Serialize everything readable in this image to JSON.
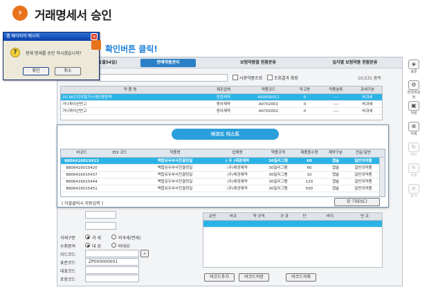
{
  "header": {
    "title": "거래명세서 승인",
    "icon": "chevron-right-icon"
  },
  "annotation": "확인버튼 클릭!",
  "tabs": [
    {
      "label": "31월54일)"
    },
    {
      "label": "판매약품관리"
    },
    {
      "label": "보험약품별 현황분류"
    },
    {
      "label": "일자별 보험약품 현황분류"
    }
  ],
  "search": {
    "chk1": "사용약품조회",
    "chk2": "조회결과 확장",
    "count": "10,531 품목"
  },
  "main_grid": {
    "columns": [
      "약 품 명",
      "제조업체",
      "약품코드",
      "마고량",
      "약품분류",
      "과세구분"
    ],
    "rows": [
      [
        "20.38건강양철가스레산용량액",
        "동원제약",
        "A00000011",
        "0",
        "----",
        "비과세"
      ],
      [
        "거나파이산반고",
        "동아제약",
        "A0702001",
        "0",
        "----",
        "비과세"
      ],
      [
        "거나파이산반고",
        "동아제약",
        "A0702002",
        "0",
        "----",
        "비과세"
      ]
    ]
  },
  "popup": {
    "title": "바코드 리스트",
    "columns": [
      "바코드",
      "EDI 코드",
      "약품명",
      "업체명",
      "약품규격",
      "제품충수량",
      "제약구분",
      "전문/일반"
    ],
    "rows": [
      [
        "8806416015413",
        "",
        "백합유두부사전결정일",
        "( 주 )태광제약",
        "30밀리그램",
        "60",
        "캡슐",
        "일반의약품"
      ],
      [
        "8806416015420",
        "",
        "백합유두부사전결정일",
        "(주)태광제약",
        "30밀리그램",
        "60",
        "캡슐",
        "일반의약품"
      ],
      [
        "8806416015437",
        "",
        "백합유두부사전결정일",
        "(주)태광제약",
        "30밀리그램",
        "10",
        "캡슐",
        "일반의약품"
      ],
      [
        "8806416015444",
        "",
        "백합유두부사전결정일",
        "(주)태광제약",
        "30밀리그램",
        "120",
        "캡슐",
        "일반의약품"
      ],
      [
        "8806416015451",
        "",
        "백합유두부사전결정일",
        "(주)태광제약",
        "30밀리그램",
        "500",
        "캡슐",
        "일반의약품"
      ]
    ],
    "footer_note": "( 더블클릭시 자동입력 )",
    "close_button": "닫 기(ESC)"
  },
  "dialog": {
    "title": "웹 페이지의 메시지",
    "message": "현재 명세를 승인 하시겠습니까?",
    "ok": "확인",
    "cancel": "취소"
  },
  "form": {
    "tax_label": "과세구분",
    "tax_opt1": "과 세",
    "tax_opt2": "비과세(면세)",
    "receive_label": "수취증여",
    "receive_opt1": "대 상",
    "receive_opt2": "비대상",
    "code_label": "리드코드",
    "mgmt_label": "표준코드",
    "mgmt_value": "ZP000000001",
    "field3_label": "대표코드",
    "field4_label": "포장코드"
  },
  "lower_grid": {
    "columns": [
      "순번",
      "바코",
      "약 규격",
      "규 과",
      "단",
      "바지",
      "빈 코"
    ]
  },
  "bottom_buttons": [
    "바코드추가",
    "바코드저장",
    "바코드삭제"
  ],
  "side_toolbar": [
    {
      "label": "표준",
      "icon": "save-icon"
    },
    {
      "label": "환경재설정",
      "icon": "settings-icon"
    },
    {
      "label": "저장",
      "icon": "disk-icon"
    },
    {
      "label": "삭제",
      "icon": "delete-icon"
    },
    {
      "label": "재시",
      "icon": "refresh-icon"
    },
    {
      "label": "수정",
      "icon": "edit-icon"
    },
    {
      "label": "닫기",
      "icon": "close-icon"
    }
  ],
  "colors": {
    "accent": "#2b9fdb",
    "select": "#2bb3e6",
    "orange": "#e8731c",
    "annotation": "#1c7fd6"
  }
}
